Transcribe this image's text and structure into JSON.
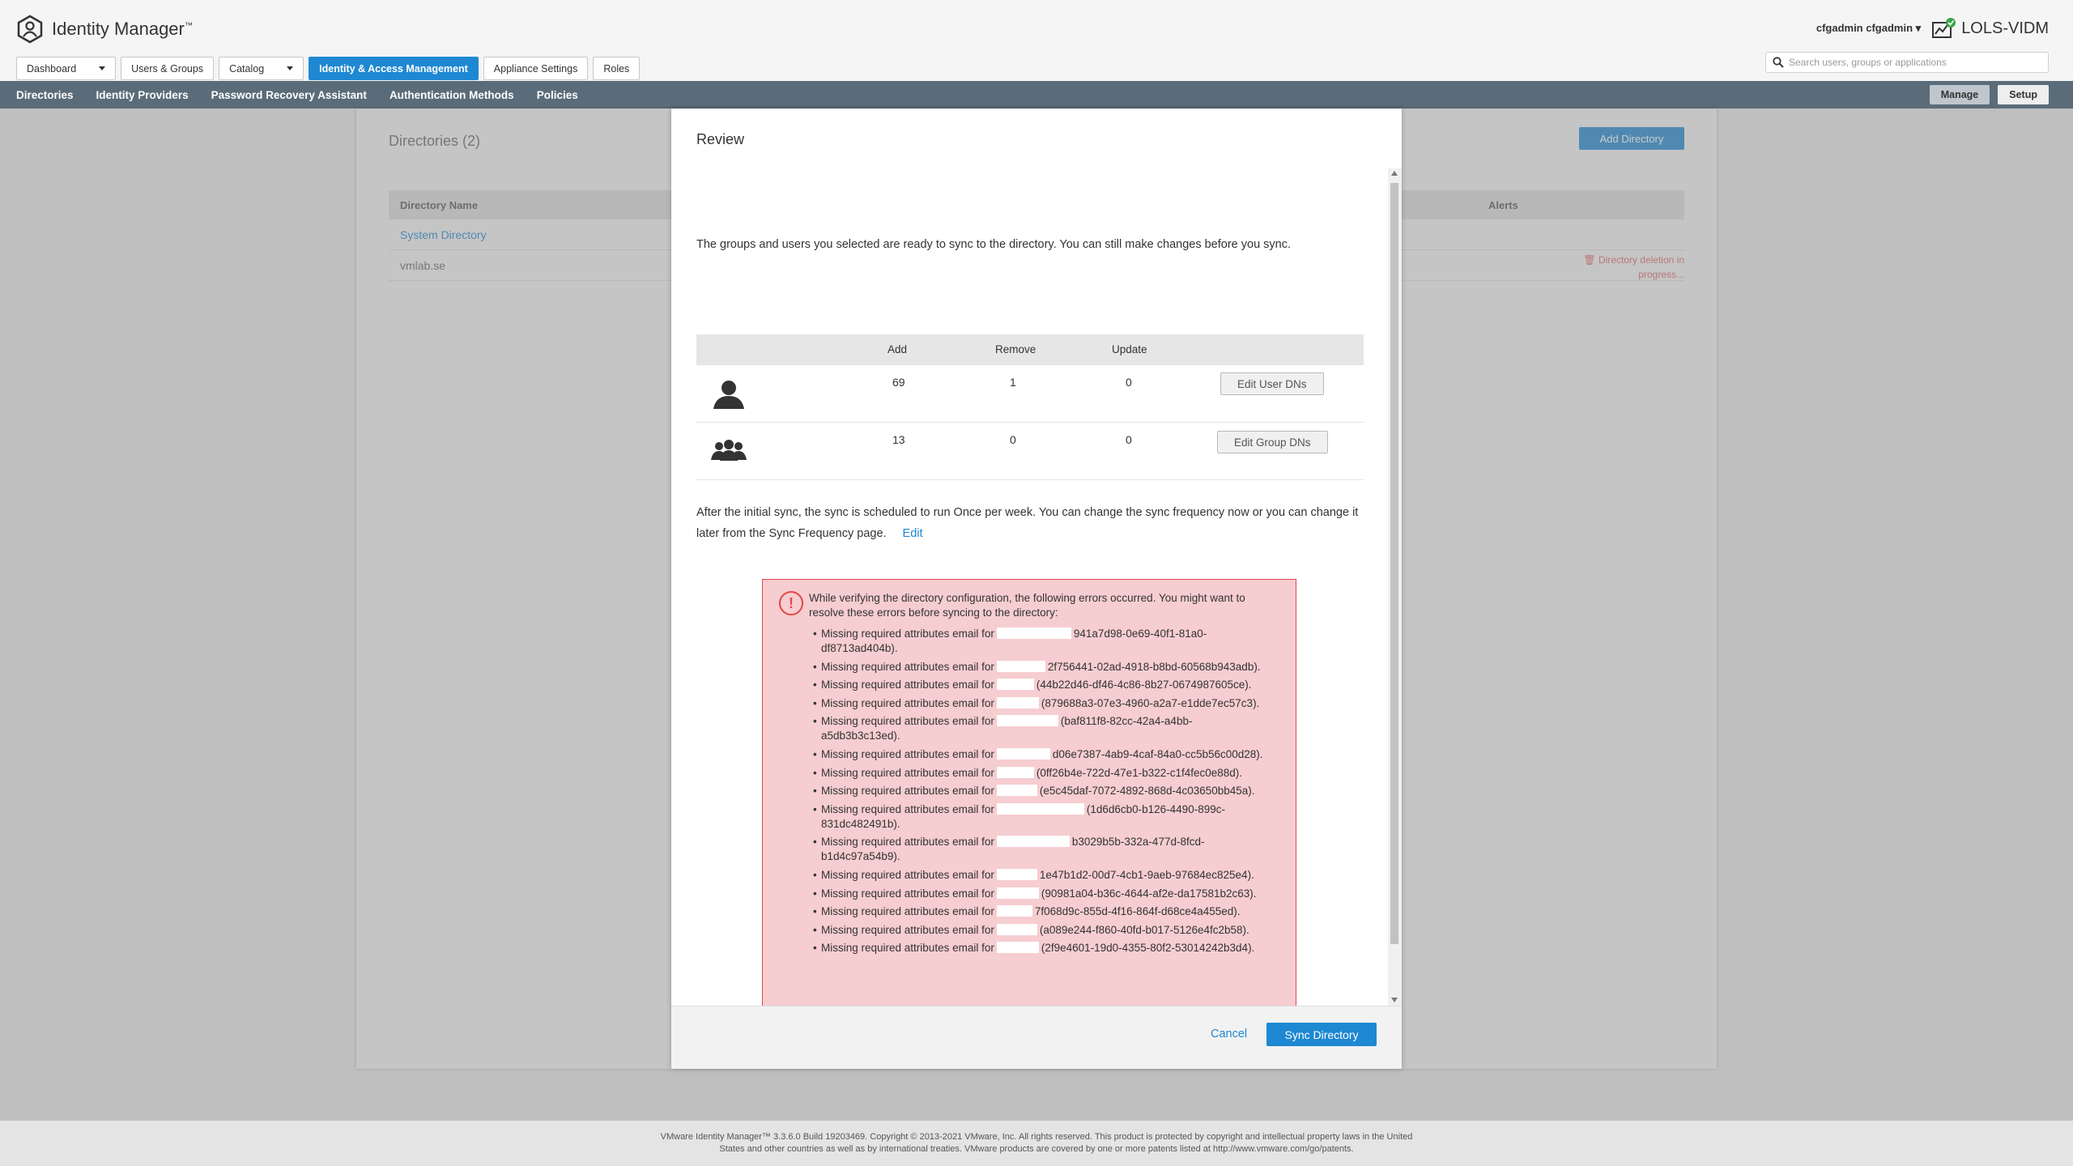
{
  "header": {
    "app_title": "Identity Manager",
    "tm": "™",
    "user": "cfgadmin cfgadmin",
    "user_caret": "▾",
    "tenant": "LOLS-VIDM",
    "search_placeholder": "Search users, groups or applications"
  },
  "main_tabs": [
    {
      "label": "Dashboard",
      "dropdown": true
    },
    {
      "label": "Users & Groups"
    },
    {
      "label": "Catalog",
      "dropdown": true
    },
    {
      "label": "Identity & Access Management",
      "active": true
    },
    {
      "label": "Appliance Settings"
    },
    {
      "label": "Roles"
    }
  ],
  "sub_nav": {
    "items": [
      "Directories",
      "Identity Providers",
      "Password Recovery Assistant",
      "Authentication Methods",
      "Policies"
    ],
    "manage": "Manage",
    "setup": "Setup"
  },
  "background": {
    "title": "Directories (2)",
    "add_button": "Add Directory",
    "col_name": "Directory Name",
    "col_alerts": "Alerts",
    "rows": [
      "System Directory",
      "vmlab.se"
    ],
    "alert_line1": "Directory deletion in",
    "alert_line2": "progress..."
  },
  "modal": {
    "title": "Review",
    "intro": "The groups and users you selected are ready to sync to the directory. You can still make changes before you sync.",
    "table_headers": {
      "add": "Add",
      "remove": "Remove",
      "update": "Update"
    },
    "users": {
      "add": "69",
      "remove": "1",
      "update": "0",
      "button": "Edit User DNs"
    },
    "groups": {
      "add": "13",
      "remove": "0",
      "update": "0",
      "button": "Edit Group DNs"
    },
    "freq_text": "After the initial sync, the sync is scheduled to run Once per week. You can change the sync frequency now or you can change it later from the Sync Frequency page.",
    "freq_edit": "Edit",
    "error_intro": "While verifying the directory configuration, the following errors occurred. You might want to resolve these errors before syncing to the directory:",
    "error_prefix": "Missing required attributes email for",
    "errors": [
      "941a7d98-0e69-40f1-81a0-df8713ad404b).",
      "2f756441-02ad-4918-b8bd-60568b943adb).",
      "(44b22d46-df46-4c86-8b27-0674987605ce).",
      "(879688a3-07e3-4960-a2a7-e1dde7ec57c3).",
      "(baf811f8-82cc-42a4-a4bb-a5db3b3c13ed).",
      "d06e7387-4ab9-4caf-84a0-cc5b56c00d28).",
      "(0ff26b4e-722d-47e1-b322-c1f4fec0e88d).",
      "(e5c45daf-7072-4892-868d-4c03650bb45a).",
      "(1d6d6cb0-b126-4490-899c-831dc482491b).",
      "b3029b5b-332a-477d-8fcd-b1d4c97a54b9).",
      "1e47b1d2-00d7-4cb1-9aeb-97684ec825e4).",
      "(90981a04-b36c-4644-af2e-da17581b2c63).",
      "7f068d9c-855d-4f16-864f-d68ce4a455ed).",
      "(a089e244-f860-40fd-b017-5126e4fc2b58).",
      "(2f9e4601-19d0-4355-80f2-53014242b3d4)."
    ],
    "cancel": "Cancel",
    "sync_button": "Sync Directory"
  },
  "footer": {
    "line1": "VMware Identity Manager™ 3.3.6.0 Build 19203469. Copyright © 2013-2021 VMware, Inc. All rights reserved. This product is protected by copyright and intellectual property laws in the United",
    "line2": "States and other countries as well as by international treaties. VMware products are covered by one or more patents listed at http://www.vmware.com/go/patents."
  }
}
